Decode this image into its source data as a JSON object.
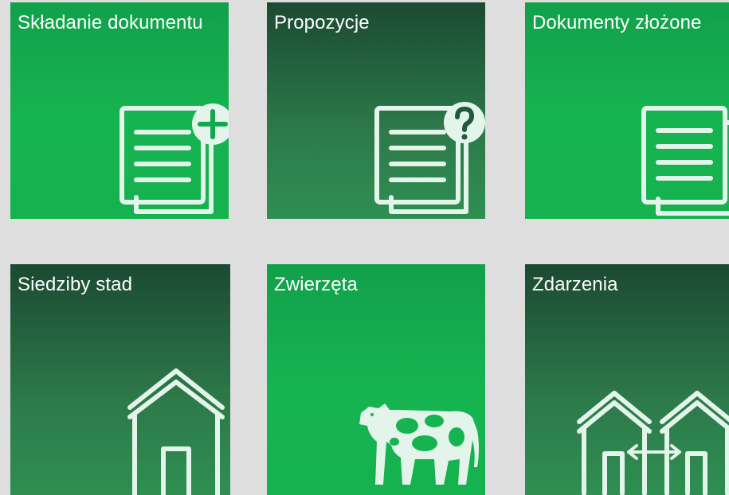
{
  "tiles": [
    {
      "title": "Składanie dokumentu",
      "icon": "document-add-icon",
      "style": "bright"
    },
    {
      "title": "Propozycje",
      "icon": "document-question-icon",
      "style": "dark"
    },
    {
      "title": "Dokumenty złożone",
      "icon": "documents-icon",
      "style": "bright"
    },
    {
      "title": "Siedziby stad",
      "icon": "house-icon",
      "style": "dark"
    },
    {
      "title": "Zwierzęta",
      "icon": "cow-icon",
      "style": "bright"
    },
    {
      "title": "Zdarzenia",
      "icon": "houses-transfer-icon",
      "style": "dark"
    }
  ],
  "colors": {
    "background": "#dedede",
    "tile_bright": "#16b451",
    "tile_dark_top": "#1b4a32",
    "tile_dark_bottom": "#2e8f52",
    "icon_stroke": "#e3f4ea",
    "text": "#ffffff"
  }
}
